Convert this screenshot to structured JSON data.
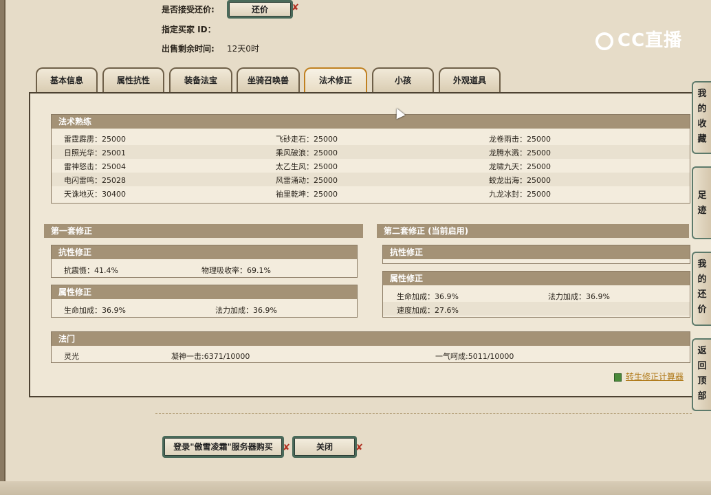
{
  "header": {
    "accept_counter_label": "是否接受还价:",
    "counter_button": "还价",
    "buyer_id_label": "指定买家 ID：",
    "time_left_label": "出售剩余时间:",
    "time_left_value": "12天0时"
  },
  "logo": {
    "text": "CC直播"
  },
  "tabs": [
    {
      "label": "基本信息"
    },
    {
      "label": "属性抗性"
    },
    {
      "label": "装备法宝"
    },
    {
      "label": "坐骑召唤兽"
    },
    {
      "label": "法术修正"
    },
    {
      "label": "小孩"
    },
    {
      "label": "外观道具"
    }
  ],
  "active_tab": "法术修正",
  "spell_mastery": {
    "title": "法术熟练",
    "rows": [
      [
        "雷霆霹雳：25000",
        "飞砂走石：25000",
        "龙卷雨击：25000"
      ],
      [
        "日照光华：25001",
        "乘风破浪：25000",
        "龙腾水溅：25000"
      ],
      [
        "雷神怒击：25004",
        "太乙生风：25000",
        "龙啸九天：25000"
      ],
      [
        "电闪雷鸣：25028",
        "风雷涌动：25000",
        "蛟龙出海：25000"
      ],
      [
        "天诛地灭：30400",
        "袖里乾坤：25000",
        "九龙冰封：25000"
      ]
    ]
  },
  "set1": {
    "title": "第一套修正",
    "resist": {
      "title": "抗性修正",
      "items": [
        "抗震慑：41.4%",
        "物理吸收率：69.1%"
      ]
    },
    "attr": {
      "title": "属性修正",
      "items": [
        "生命加成：36.9%",
        "法力加成：36.9%"
      ]
    }
  },
  "set2": {
    "title": "第二套修正 (当前启用)",
    "resist": {
      "title": "抗性修正"
    },
    "attr": {
      "title": "属性修正",
      "items": [
        "生命加成：36.9%",
        "法力加成：36.9%",
        "速度加成：27.6%"
      ]
    }
  },
  "school": {
    "title": "法门",
    "items": [
      "灵光",
      "凝神一击:6371/10000",
      "一气呵成:5011/10000"
    ]
  },
  "calculator_link": "转生修正计算器",
  "side_tabs": [
    "我的收藏",
    "足迹",
    "我的还价",
    "返回顶部"
  ],
  "footer": {
    "login_buy_button": "登录\"傲雪凌霜\"服务器购买",
    "close_button": "关闭"
  }
}
